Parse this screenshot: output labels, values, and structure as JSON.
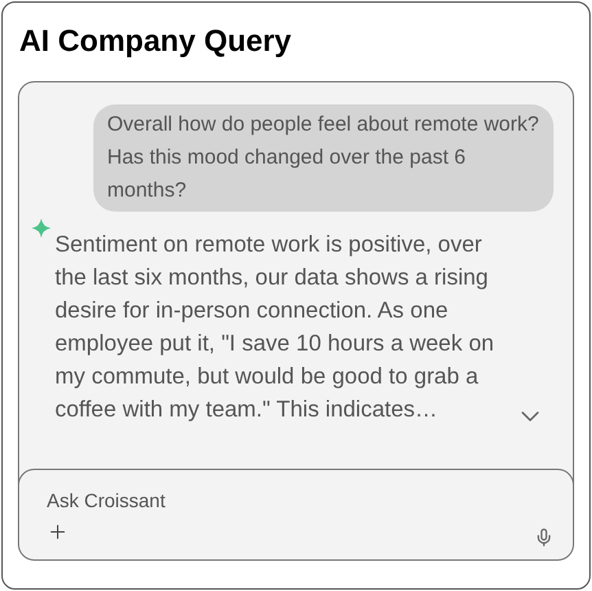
{
  "title": "AI Company Query",
  "messages": [
    {
      "kind": "user",
      "text": "Overall how do people feel about remote work? Has this mood changed over the past 6 months?"
    },
    {
      "kind": "assistant",
      "text": "Sentiment on remote work is positive, over the last six months, our data shows a rising desire for in-person connection. As one employee put it, \"I save 10 hours a week on my commute, but would be good to grab a coffee with my team.\" This indicates…",
      "collapsed": true
    }
  ],
  "composer": {
    "placeholder": "Ask Croissant"
  }
}
